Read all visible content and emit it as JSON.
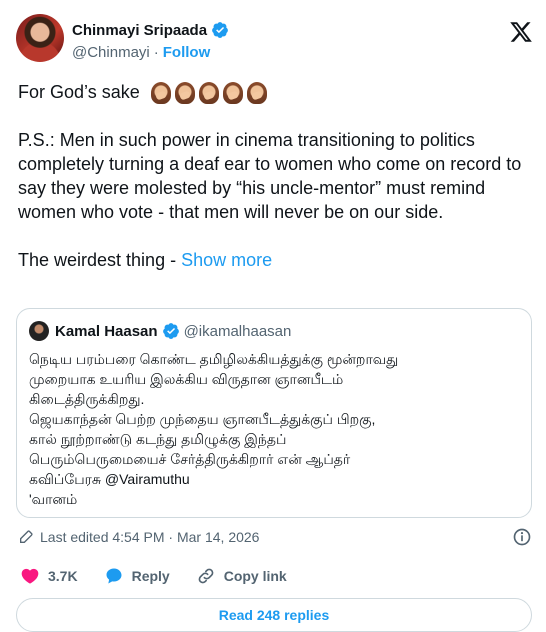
{
  "author": {
    "display_name": "Chinmayi Sripaada",
    "handle": "@Chinmayi",
    "separator": "·",
    "follow_label": "Follow"
  },
  "tweet": {
    "line1": "For God’s sake",
    "emoji_count": 5,
    "paragraph2": "P.S.: Men in such power in cinema transitioning to politics completely turning a deaf ear to women who come on record to say they were molested by “his uncle-mentor” must remind women who vote - that men will never be on our side.",
    "paragraph3_prefix": "The weirdest thing - ",
    "show_more": "Show more"
  },
  "quote": {
    "display_name": "Kamal Haasan",
    "handle": "@ikamalhaasan",
    "lines": [
      "நெடிய பரம்பரை கொண்ட தமிழிலக்கியத்துக்கு மூன்றாவது",
      "முறையாக உயரிய இலக்கிய விருதான ஞானபீடம்",
      "கிடைத்திருக்கிறது.",
      "ஜெயகாந்தன் பெற்ற முந்தைய ஞானபீடத்துக்குப் பிறகு,",
      "கால் நூற்றாண்டு கடந்து தமிழுக்கு இந்தப்",
      "பெரும்பெருமையைச் சேர்த்திருக்கிறார் என் ஆப்தர்",
      "கவிப்பேரசு @Vairamuthu",
      "'வானம்"
    ]
  },
  "meta": {
    "edited_text": "Last edited 4:54 PM · Mar 14, 2026"
  },
  "actions": {
    "like_count": "3.7K",
    "reply_label": "Reply",
    "copy_link_label": "Copy link"
  },
  "replies": {
    "read_label": "Read 248 replies"
  },
  "colors": {
    "accent": "#1d9bf0",
    "like": "#f91880",
    "secondary_text": "#536471",
    "border": "#cfd9de"
  }
}
